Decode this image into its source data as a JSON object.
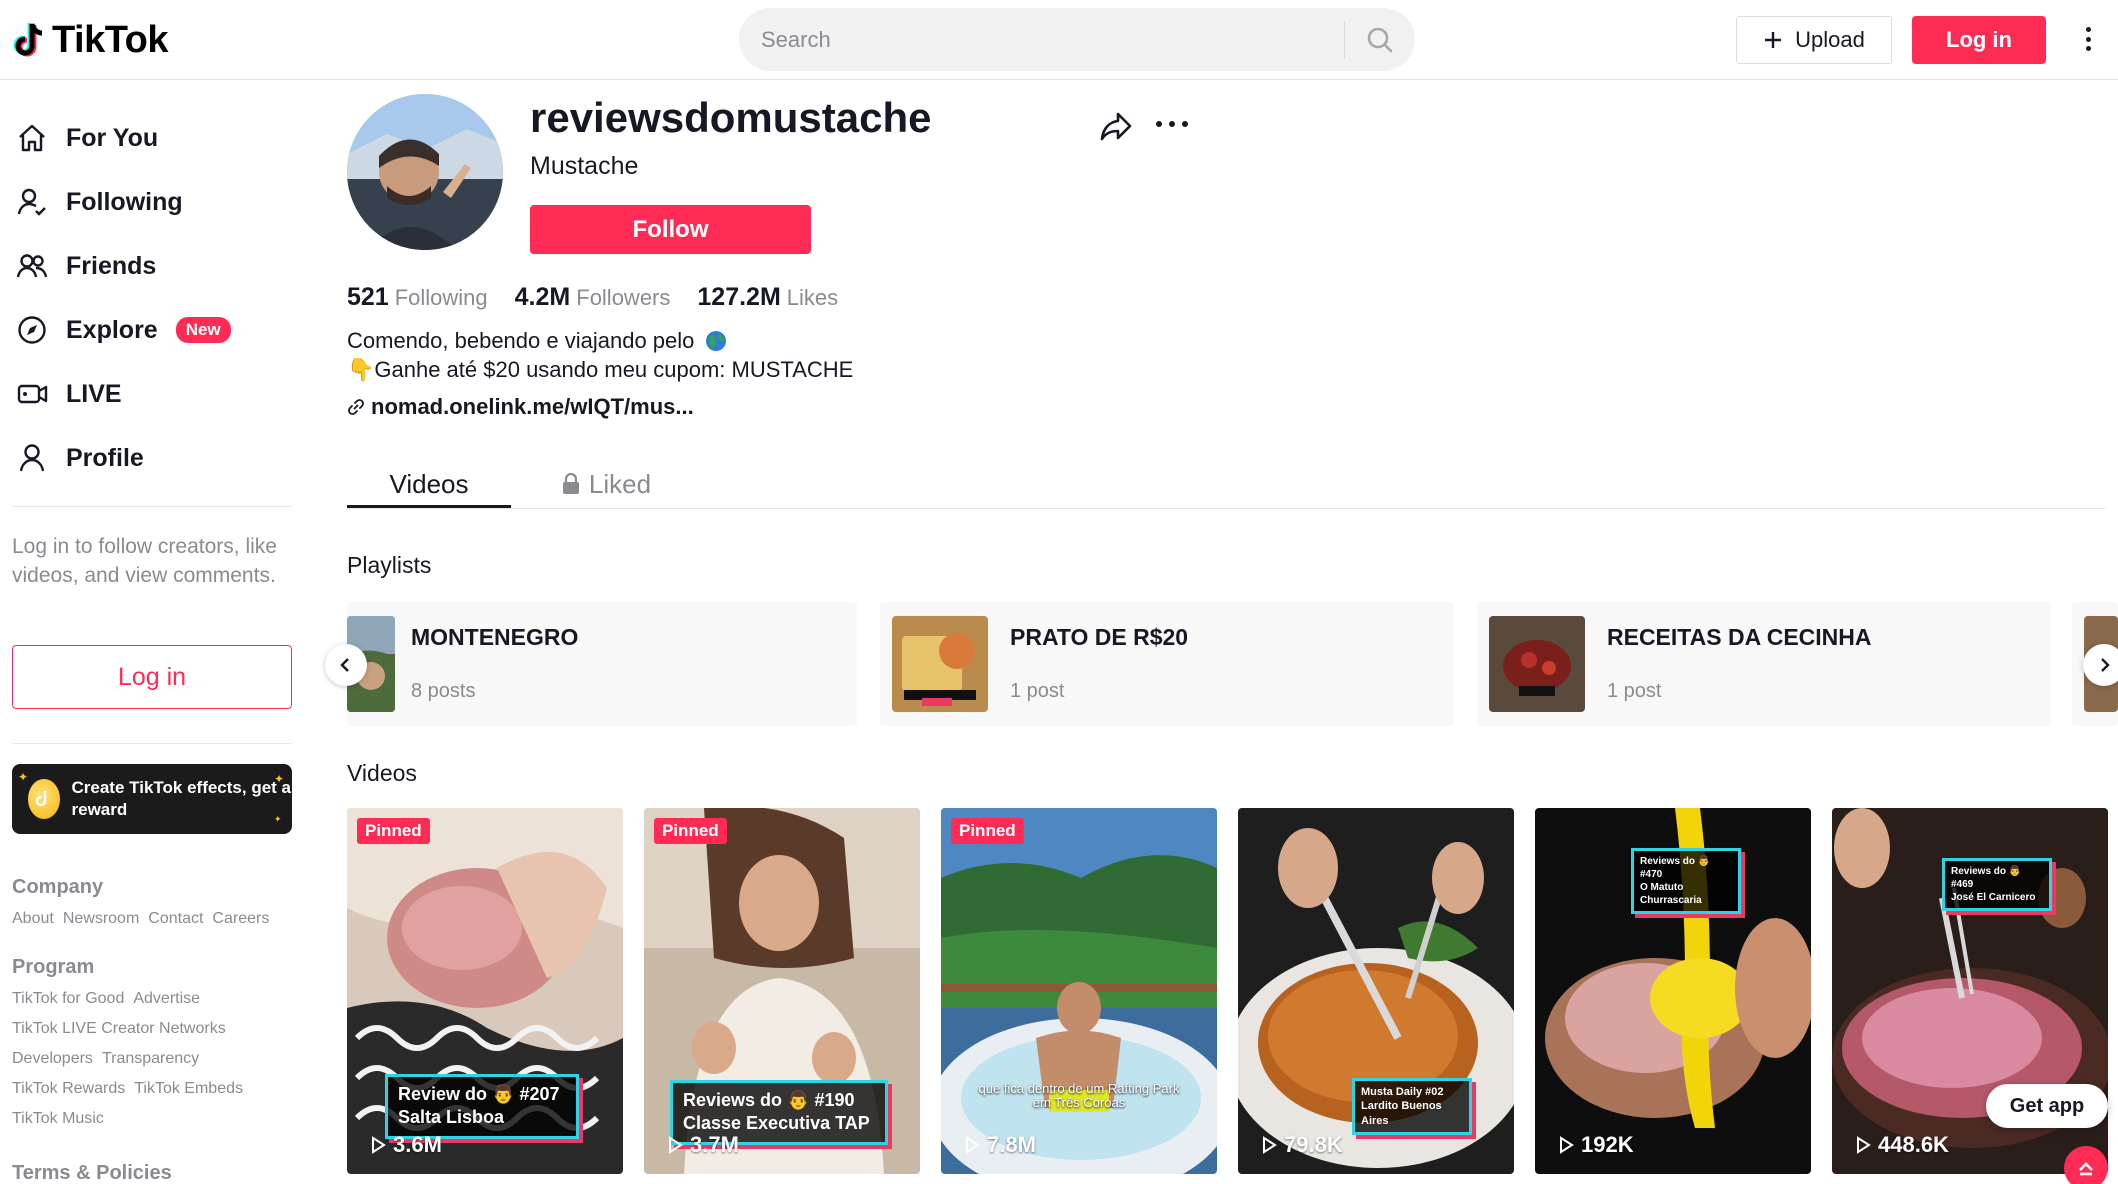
{
  "header": {
    "logo_text": "TikTok",
    "search_placeholder": "Search",
    "upload_label": "Upload",
    "login_label": "Log in"
  },
  "sidebar": {
    "nav": [
      {
        "label": "For You",
        "icon": "home-icon"
      },
      {
        "label": "Following",
        "icon": "following-icon"
      },
      {
        "label": "Friends",
        "icon": "friends-icon"
      },
      {
        "label": "Explore",
        "icon": "explore-icon",
        "badge": "New"
      },
      {
        "label": "LIVE",
        "icon": "live-icon"
      },
      {
        "label": "Profile",
        "icon": "profile-icon"
      }
    ],
    "login_hint": "Log in to follow creators, like videos, and view comments.",
    "login_button": "Log in",
    "effects_banner": "Create TikTok effects, get a reward",
    "footer": {
      "company_title": "Company",
      "company_links": [
        "About",
        "Newsroom",
        "Contact",
        "Careers"
      ],
      "program_title": "Program",
      "program_links": [
        "TikTok for Good",
        "Advertise",
        "TikTok LIVE Creator Networks",
        "Developers",
        "Transparency",
        "TikTok Rewards",
        "TikTok Embeds",
        "TikTok Music"
      ],
      "terms_title": "Terms & Policies"
    }
  },
  "profile": {
    "username": "reviewsdomustache",
    "nickname": "Mustache",
    "follow_label": "Follow",
    "stats": [
      {
        "value": "521",
        "label": "Following"
      },
      {
        "value": "4.2M",
        "label": "Followers"
      },
      {
        "value": "127.2M",
        "label": "Likes"
      }
    ],
    "bio_line1": "Comendo, bebendo e viajando pelo",
    "bio_line2": "👇Ganhe até $20 usando meu cupom: MUSTACHE",
    "link": "nomad.onelink.me/wIQT/mus..."
  },
  "tabs": {
    "videos": "Videos",
    "liked": "Liked"
  },
  "playlists": {
    "title": "Playlists",
    "items": [
      {
        "name": "MONTENEGRO",
        "count": "8 posts"
      },
      {
        "name": "PRATO DE R$20",
        "count": "1 post"
      },
      {
        "name": "RECEITAS DA CECINHA",
        "count": "1 post"
      }
    ]
  },
  "videos": {
    "title": "Videos",
    "pinned_label": "Pinned",
    "items": [
      {
        "views": "3.6M",
        "pinned": true,
        "caption1": "Review do 👨 #207",
        "caption2": "Salta Lisboa"
      },
      {
        "views": "3.7M",
        "pinned": true,
        "caption1": "Reviews do 👨 #190",
        "caption2": "Classe Executiva TAP"
      },
      {
        "views": "7.8M",
        "pinned": true,
        "caption1": "que fica dentro de um Rafting Park",
        "caption2": "em Três Coroas"
      },
      {
        "views": "79.8K",
        "pinned": false,
        "caption1": "Musta Daily #02",
        "caption2": "Lardito Buenos Aires"
      },
      {
        "views": "192K",
        "pinned": false,
        "caption1": "Reviews do 👨 #470",
        "caption2": "O Matuto Churrascaria"
      },
      {
        "views": "448.6K",
        "pinned": false,
        "caption1": "Reviews do 👨 #469",
        "caption2": "José El Carnicero"
      }
    ],
    "get_app": "Get app"
  },
  "colors": {
    "accent": "#fe2c55",
    "text": "#161823",
    "muted": "#8a8b91"
  }
}
